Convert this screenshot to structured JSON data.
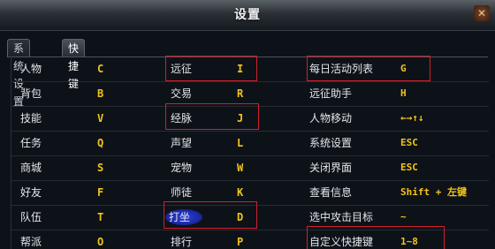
{
  "window": {
    "title": "设置",
    "close_icon": "close-icon"
  },
  "tabs": [
    {
      "label": "系统设置",
      "active": false
    },
    {
      "label": "快捷键",
      "active": true
    }
  ],
  "shortcuts": [
    [
      {
        "label": "人物",
        "key": "C"
      },
      {
        "label": "远征",
        "key": "I"
      },
      {
        "label": "每日活动列表",
        "key": "G"
      }
    ],
    [
      {
        "label": "背包",
        "key": "B"
      },
      {
        "label": "交易",
        "key": "R"
      },
      {
        "label": "远征助手",
        "key": "H"
      }
    ],
    [
      {
        "label": "技能",
        "key": "V"
      },
      {
        "label": "经脉",
        "key": "J"
      },
      {
        "label": "人物移动",
        "key": "←→↑↓"
      }
    ],
    [
      {
        "label": "任务",
        "key": "Q"
      },
      {
        "label": "声望",
        "key": "L"
      },
      {
        "label": "系统设置",
        "key": "ESC"
      }
    ],
    [
      {
        "label": "商城",
        "key": "S"
      },
      {
        "label": "宠物",
        "key": "W"
      },
      {
        "label": "关闭界面",
        "key": "ESC"
      }
    ],
    [
      {
        "label": "好友",
        "key": "F"
      },
      {
        "label": "师徒",
        "key": "K"
      },
      {
        "label": "查看信息",
        "key": "Shift + 左键"
      }
    ],
    [
      {
        "label": "队伍",
        "key": "T"
      },
      {
        "label": "打坐",
        "key": "D"
      },
      {
        "label": "选中攻击目标",
        "key": "~"
      }
    ],
    [
      {
        "label": "帮派",
        "key": "O"
      },
      {
        "label": "排行",
        "key": "P"
      },
      {
        "label": "自定义快捷键",
        "key": "1~8"
      }
    ]
  ],
  "colors": {
    "key_text": "#f3c417",
    "highlight_border": "#d11f2a"
  }
}
